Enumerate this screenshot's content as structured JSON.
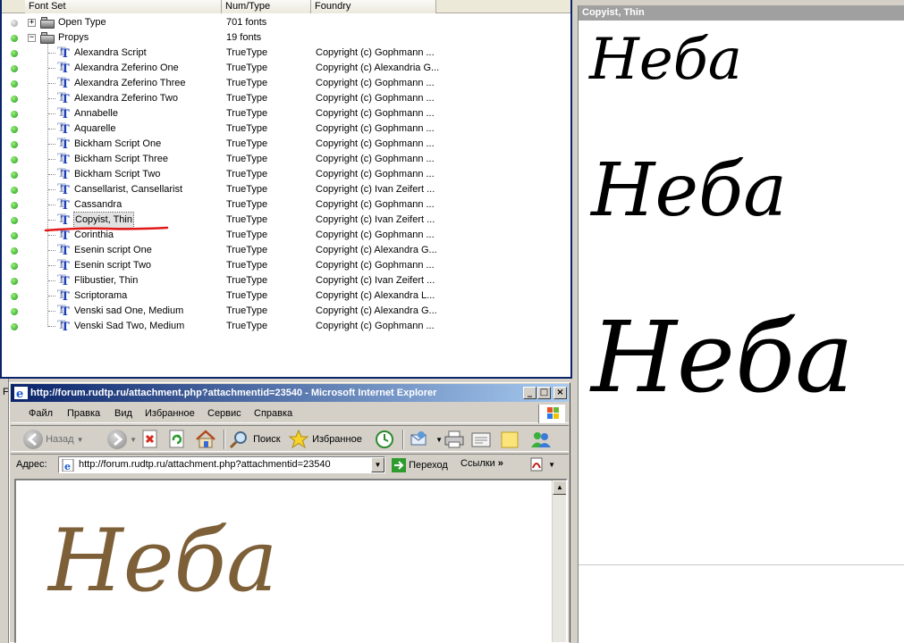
{
  "font_list": {
    "columns": [
      "Font Set",
      "Num/Type",
      "Foundry"
    ],
    "groups": [
      {
        "name": "Open Type",
        "count": "701 fonts",
        "expanded": false
      },
      {
        "name": "Propys",
        "count": "19 fonts",
        "expanded": true
      }
    ],
    "fonts": [
      {
        "name": "Alexandra Script",
        "type": "TrueType",
        "foundry": "Copyright (c) Gophmann ..."
      },
      {
        "name": "Alexandra Zeferino One",
        "type": "TrueType",
        "foundry": "Copyright (c) Alexandria G..."
      },
      {
        "name": "Alexandra Zeferino Three",
        "type": "TrueType",
        "foundry": "Copyright (c) Gophmann ..."
      },
      {
        "name": "Alexandra Zeferino Two",
        "type": "TrueType",
        "foundry": "Copyright (c) Gophmann ..."
      },
      {
        "name": "Annabelle",
        "type": "TrueType",
        "foundry": "Copyright (c) Gophmann ..."
      },
      {
        "name": "Aquarelle",
        "type": "TrueType",
        "foundry": "Copyright (c) Gophmann ..."
      },
      {
        "name": "Bickham Script One",
        "type": "TrueType",
        "foundry": "Copyright (c) Gophmann ..."
      },
      {
        "name": "Bickham Script Three",
        "type": "TrueType",
        "foundry": "Copyright (c) Gophmann ..."
      },
      {
        "name": "Bickham Script Two",
        "type": "TrueType",
        "foundry": "Copyright (c) Gophmann ..."
      },
      {
        "name": "Cansellarist, Cansellarist",
        "type": "TrueType",
        "foundry": "Copyright (c) Ivan Zeifert ..."
      },
      {
        "name": "Cassandra",
        "type": "TrueType",
        "foundry": "Copyright (c) Gophmann ..."
      },
      {
        "name": "Copyist, Thin",
        "type": "TrueType",
        "foundry": "Copyright (c) Ivan Zeifert ..."
      },
      {
        "name": "Corinthia",
        "type": "TrueType",
        "foundry": "Copyright (c) Gophmann ..."
      },
      {
        "name": "Esenin script One",
        "type": "TrueType",
        "foundry": "Copyright (c) Alexandra G..."
      },
      {
        "name": "Esenin script Two",
        "type": "TrueType",
        "foundry": "Copyright (c) Gophmann ..."
      },
      {
        "name": "Flibustier, Thin",
        "type": "TrueType",
        "foundry": "Copyright (c) Ivan Zeifert ..."
      },
      {
        "name": "Scriptorama",
        "type": "TrueType",
        "foundry": "Copyright (c) Alexandra L..."
      },
      {
        "name": "Venski sad One, Medium",
        "type": "TrueType",
        "foundry": "Copyright (c) Alexandra G..."
      },
      {
        "name": "Venski Sad Two, Medium",
        "type": "TrueType",
        "foundry": "Copyright (c) Gophmann ..."
      }
    ],
    "selected_index": 11
  },
  "preview": {
    "title": "Copyist, Thin",
    "sample_text": "Неба"
  },
  "ie": {
    "title": "http://forum.rudtp.ru/attachment.php?attachmentid=23540 - Microsoft Internet Explorer",
    "menu": [
      "Файл",
      "Правка",
      "Вид",
      "Избранное",
      "Сервис",
      "Справка"
    ],
    "toolbar": {
      "back": "Назад",
      "search": "Поиск",
      "favorites": "Избранное"
    },
    "address_label": "Адрес:",
    "address_value": "http://forum.rudtp.ru/attachment.php?attachmentid=23540",
    "go_label": "Переход",
    "links_label": "Ссылки",
    "content_sample": "Неба"
  },
  "stub_label": "F",
  "colors": {
    "selection_border": "#0a246a",
    "status_green": "#1d9a1a",
    "underline_red": "#e01818",
    "sample_brown": "#7d6038"
  }
}
